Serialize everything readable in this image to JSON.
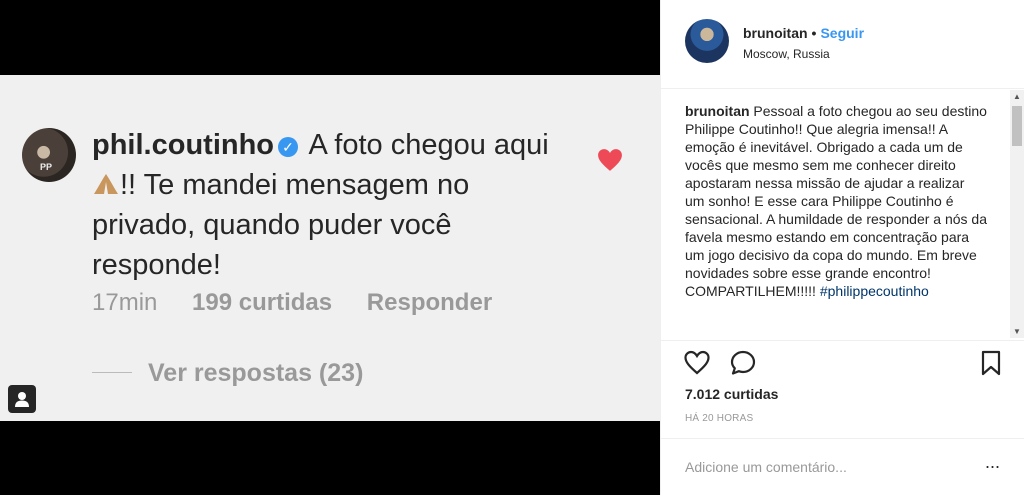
{
  "photo_comment": {
    "username": "phil.coutinho",
    "text_before_emoji": "A foto chegou aqui",
    "text_after_emoji": "!! Te mandei mensagem no privado, quando puder você responde!",
    "time": "17min",
    "likes": "199 curtidas",
    "reply": "Responder",
    "view_replies": "Ver respostas (23)",
    "heart_color": "#ed4956"
  },
  "post": {
    "username": "brunoitan",
    "separator": "•",
    "follow": "Seguir",
    "location": "Moscow, Russia",
    "caption_user": "brunoitan",
    "caption_text": " Pessoal a foto chegou ao seu destino Philippe Coutinho!! Que alegria imensa!! A emoção é inevitável. Obrigado a cada um de vocês que mesmo sem me conhecer direito apostaram nessa missão de ajudar a realizar um sonho! E esse cara Philippe Coutinho é sensacional. A humildade de responder a nós da favela mesmo estando em concentração para um jogo decisivo da copa do mundo. Em breve novidades sobre esse grande encontro! COMPARTILHEM!!!!! ",
    "caption_tag": "#philippecoutinho",
    "likes": "7.012 curtidas",
    "time": "HÁ 20 HORAS",
    "comment_placeholder": "Adicione um comentário...",
    "more": "..."
  },
  "icons": [
    "heart-icon",
    "comment-icon",
    "bookmark-icon",
    "verified-badge-icon",
    "pray-emoji-icon",
    "camera-icon"
  ],
  "colors": {
    "link": "#3897f0",
    "text": "#262626",
    "muted": "#999999"
  }
}
